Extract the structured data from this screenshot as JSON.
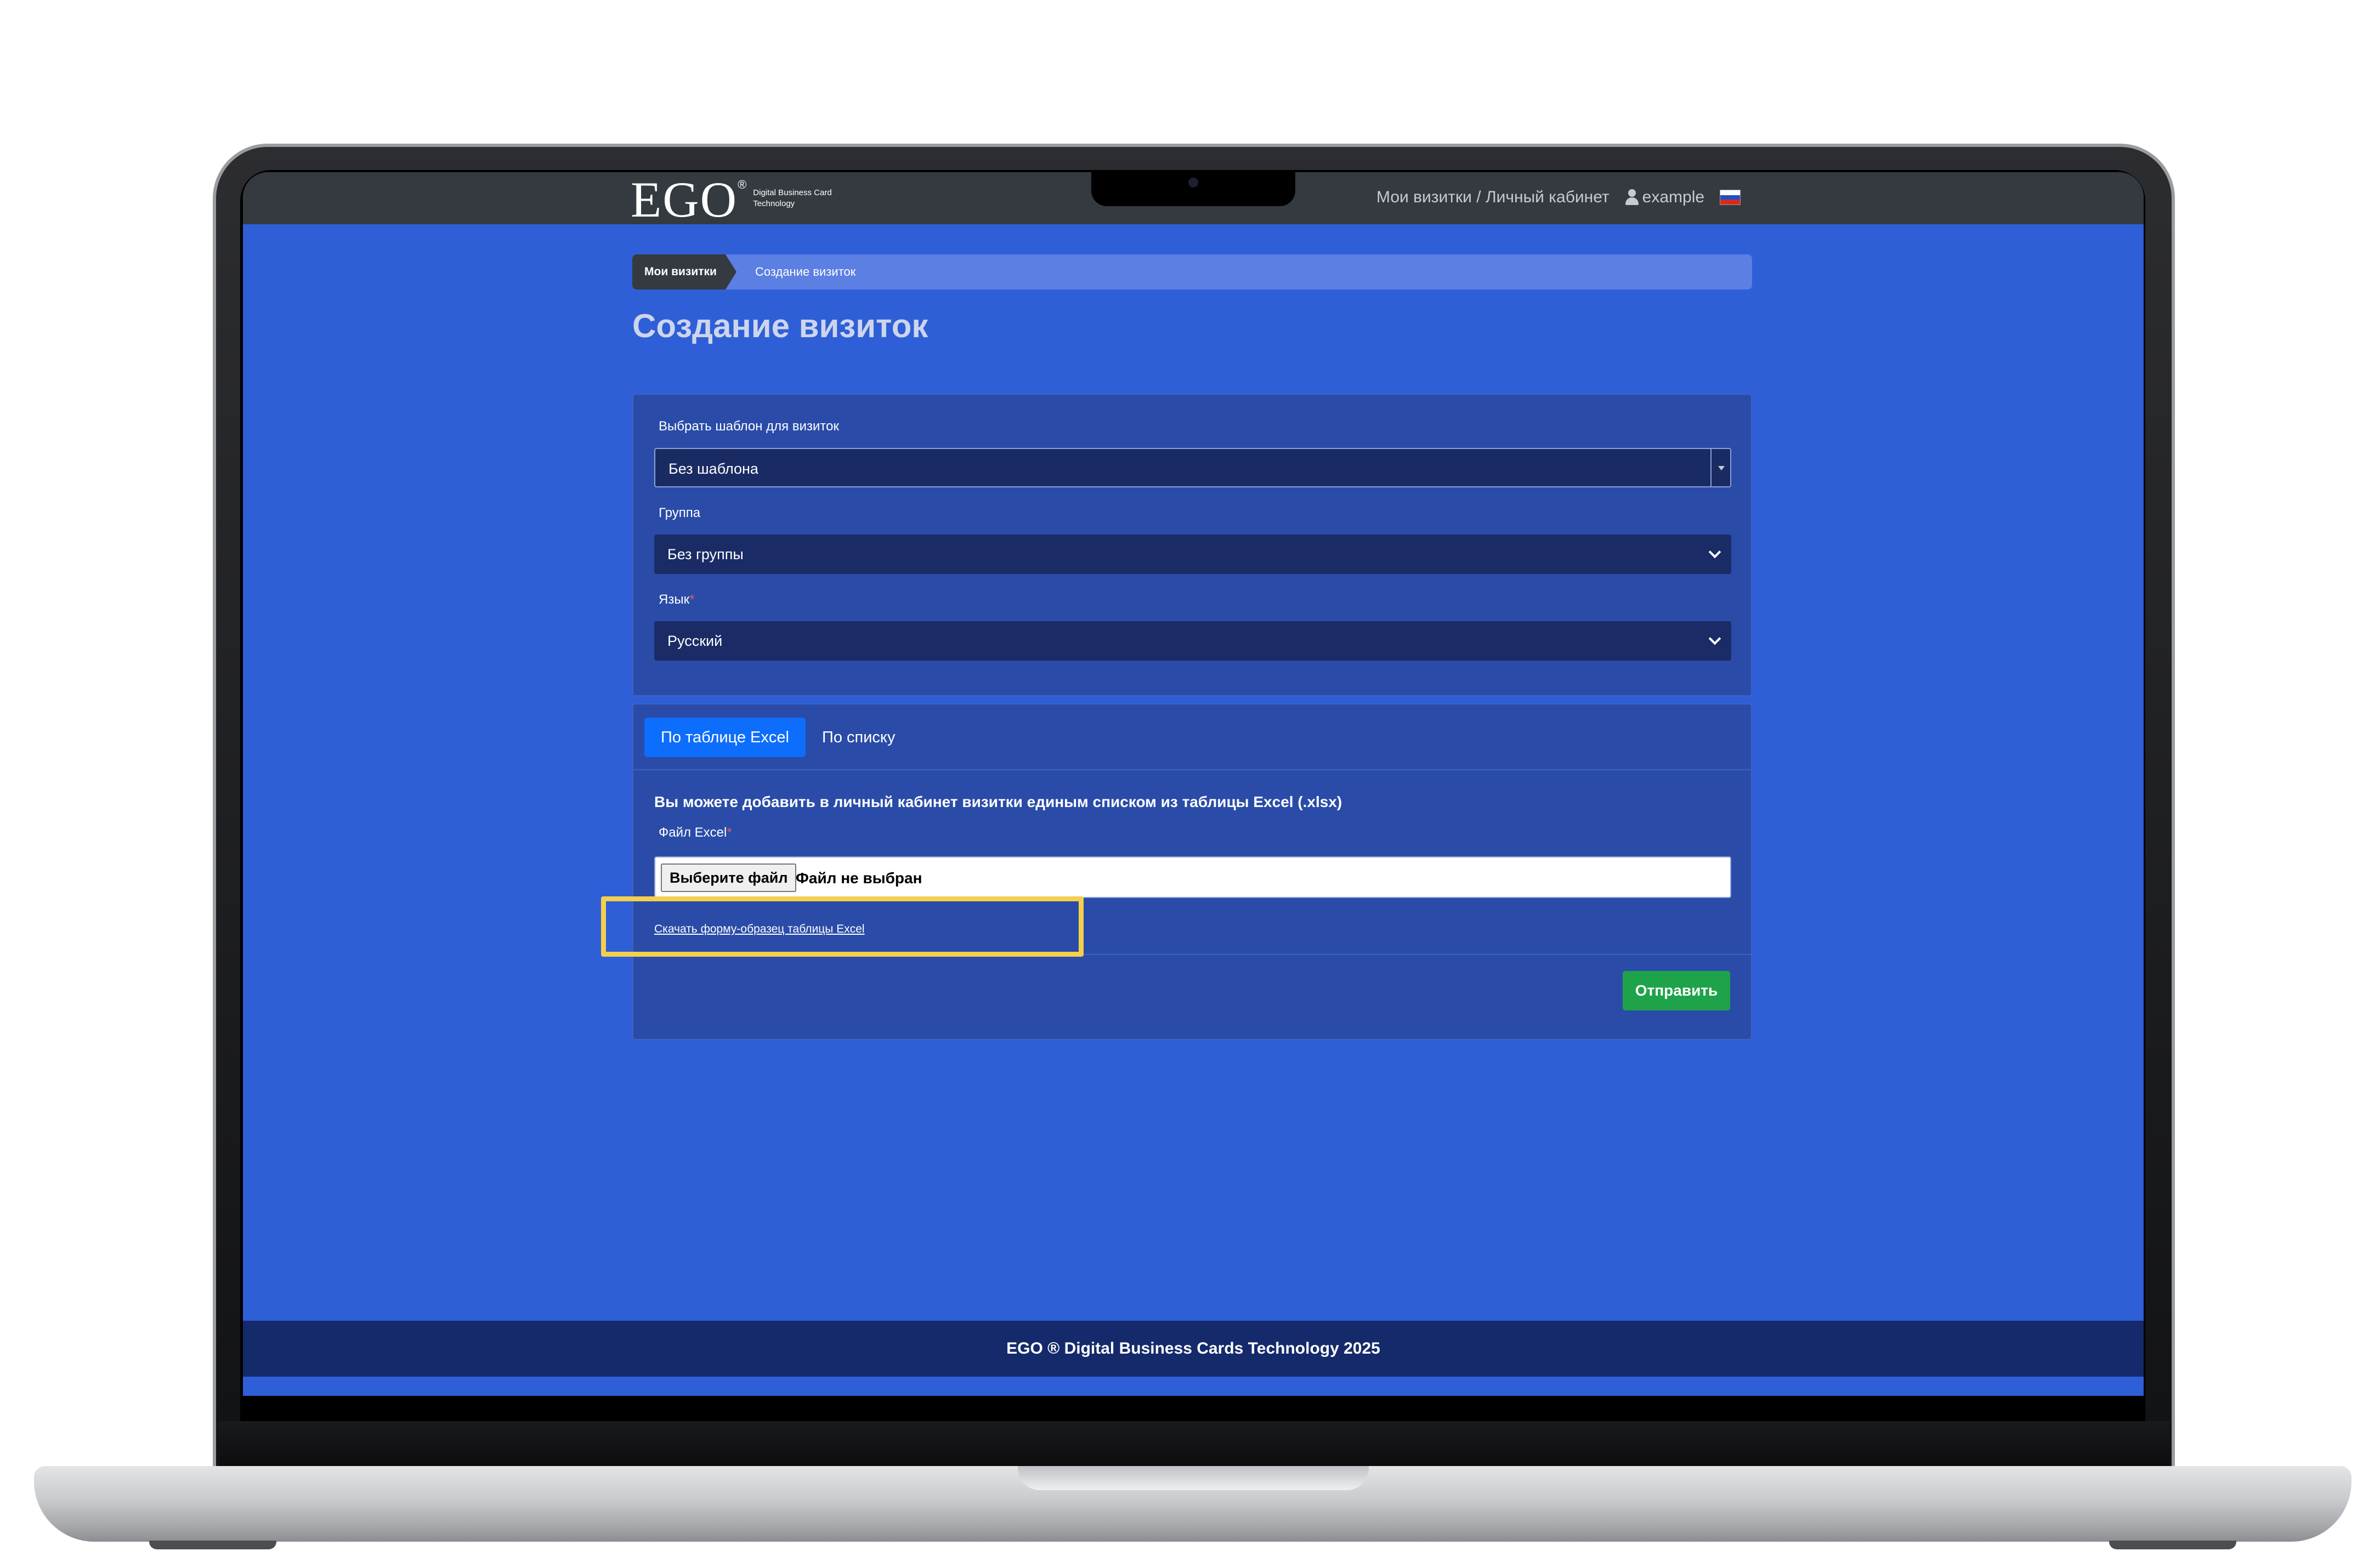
{
  "header": {
    "logo_text": "EGO",
    "logo_reg": "®",
    "logo_tagline": "Digital Business Card Technology",
    "nav_links": "Мои визитки / Личный кабинет",
    "username": "example",
    "language_flag": "ru-flag"
  },
  "breadcrumb": {
    "home": "Мои визитки",
    "current": "Создание визиток"
  },
  "page": {
    "title": "Создание визиток"
  },
  "settings": {
    "template_label": "Выбрать шаблон для визиток",
    "template_value": "Без шаблона",
    "group_label": "Группа",
    "group_value": "Без группы",
    "language_label": "Язык",
    "language_required": "*",
    "language_value": "Русский"
  },
  "upload": {
    "tabs": [
      "По таблице Excel",
      "По списку"
    ],
    "active_tab": "По таблице Excel",
    "description": "Вы можете добавить в личный кабинет визитки единым списком из таблицы Excel (.xlsx)",
    "file_label": "Файл Excel",
    "file_required": "*",
    "file_button": "Выберите файл",
    "file_status": "Файл не выбран",
    "download_link": "Скачать форму-образец таблицы Excel",
    "submit": "Отправить"
  },
  "footer": {
    "text": "EGO ® Digital Business Cards Technology 2025"
  },
  "colors": {
    "page_background": "#2f5fd7",
    "header": "#343a40",
    "card": "#2a4ca8",
    "select": "#1a2b66",
    "tab_active": "#0d6efd",
    "submit": "#1fa34a",
    "footer": "#142a6a",
    "highlight": "#f4cf4b"
  }
}
